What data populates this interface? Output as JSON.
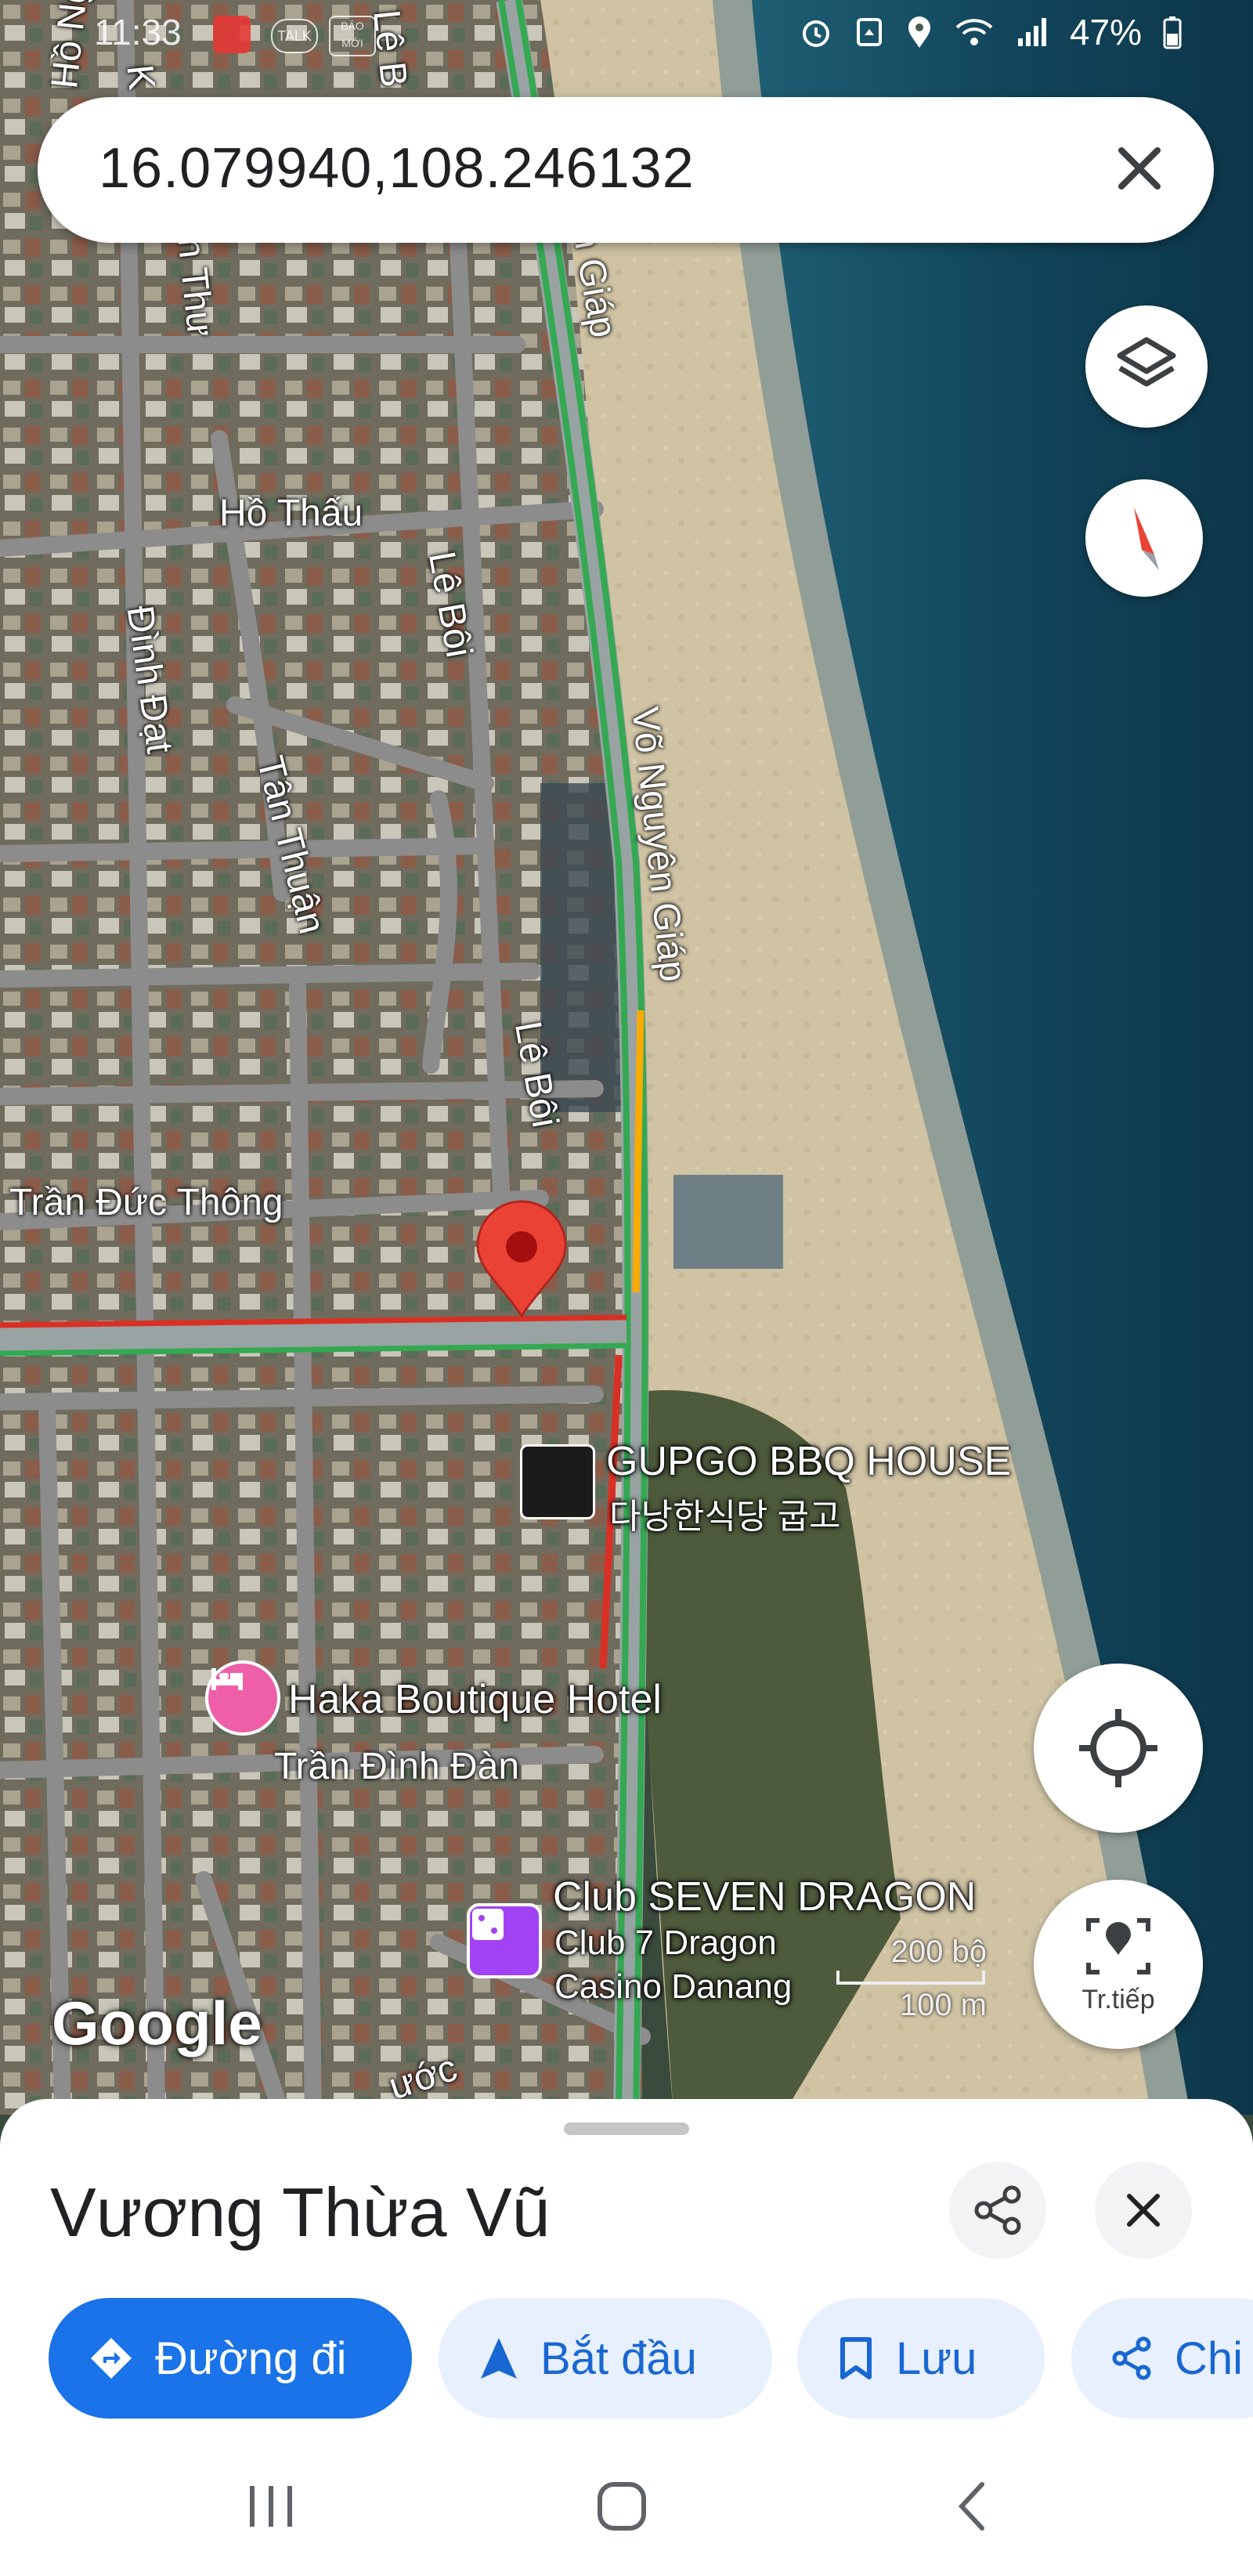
{
  "status_bar": {
    "time": "11:33",
    "battery": "47%",
    "icons": [
      "alarm-icon",
      "recycle-icon",
      "location-icon",
      "wifi-icon",
      "signal-icon",
      "battery-icon"
    ]
  },
  "search": {
    "query": "16.079940,108.246132"
  },
  "map": {
    "streets": [
      {
        "id": "ho-thau",
        "name": "Hồ Thấu"
      },
      {
        "id": "le-boi-1",
        "name": "Lê Bôi"
      },
      {
        "id": "le-boi-2",
        "name": "Lê Bôi"
      },
      {
        "id": "dinh-dat",
        "name": "Đình Đạt"
      },
      {
        "id": "tan-thuan",
        "name": "Tân Thuận"
      },
      {
        "id": "vo-nguyen-giap",
        "name": "Võ Nguyên Giáp"
      },
      {
        "id": "nguyen-giap-top",
        "name": "uyên Giáp"
      },
      {
        "id": "tran-duc-thong",
        "name": "Trần Đức Thông"
      },
      {
        "id": "tran-dinh-dan",
        "name": "Trần Đình Đàn"
      },
      {
        "id": "ho-nghinh",
        "name": "Hồ Nghinh"
      },
      {
        "id": "le-b-top",
        "name": "Lê B"
      },
      {
        "id": "an-thu",
        "name": "n Thư"
      },
      {
        "id": "k-street",
        "name": "K"
      },
      {
        "id": "bottom-street",
        "name": "ước"
      }
    ],
    "places": [
      {
        "id": "gupgo",
        "name": "GUPGO BBQ HOUSE",
        "subtitle": "다낭한식당 굽고"
      },
      {
        "id": "haka",
        "name": "Haka Boutique Hotel"
      },
      {
        "id": "seven-dragon",
        "name": "Club SEVEN DRAGON",
        "subtitle_1": "Club 7 Dragon",
        "subtitle_2": "Casino Danang"
      }
    ],
    "status_badges": [
      "TALK",
      "BÁO MỚI"
    ],
    "scale": {
      "imperial": "200 bộ",
      "metric": "100 m"
    },
    "attribution": "Google",
    "continue_label": "Tr.tiếp",
    "colors": {
      "pin": "#ea4335",
      "traffic_green": "#34a853",
      "traffic_red": "#d93025",
      "traffic_orange": "#f9ab00",
      "hotel_pink": "#ee5fa7",
      "casino_purple": "#a142f4",
      "primary": "#1a73e8"
    }
  },
  "sheet": {
    "title": "Vương Thừa Vũ",
    "chips": [
      {
        "label": "Đường đi",
        "icon": "directions-icon"
      },
      {
        "label": "Bắt đầu",
        "icon": "navigation-arrow-icon"
      },
      {
        "label": "Lưu",
        "icon": "bookmark-icon"
      },
      {
        "label": "Chi",
        "icon": "share-icon"
      }
    ]
  }
}
